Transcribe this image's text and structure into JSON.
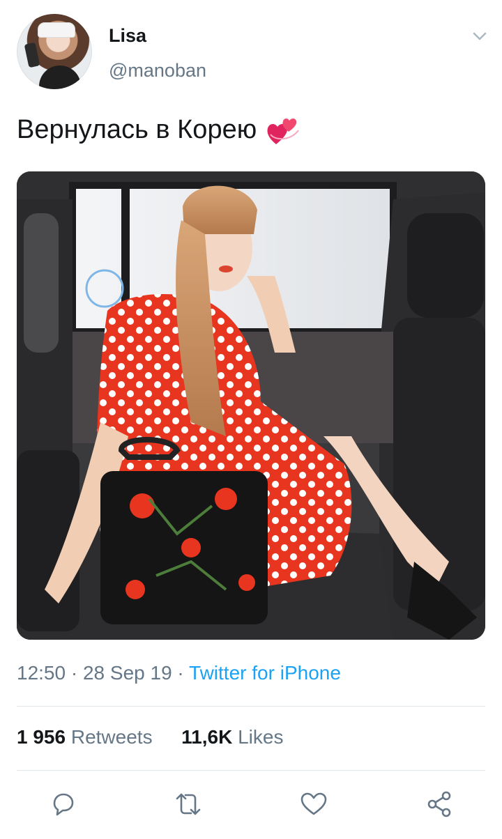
{
  "tweet": {
    "display_name": "Lisa",
    "handle": "@manoban",
    "text": "Вернулась в Корею",
    "emoji_icon": "revolving-hearts-icon",
    "time": "12:50",
    "date": "28 Sep 19",
    "separator": "·",
    "source": "Twitter for iPhone"
  },
  "stats": {
    "retweets_count": "1 956",
    "retweets_label": "Retweets",
    "likes_count": "11,6K",
    "likes_label": "Likes"
  },
  "actions": [
    {
      "icon": "reply-icon"
    },
    {
      "icon": "retweet-icon"
    },
    {
      "icon": "like-icon"
    },
    {
      "icon": "share-icon"
    }
  ],
  "colors": {
    "accent": "#1da1f2",
    "secondary_text": "#657786",
    "primary_text": "#14171a",
    "divider": "#e1e8ed"
  }
}
